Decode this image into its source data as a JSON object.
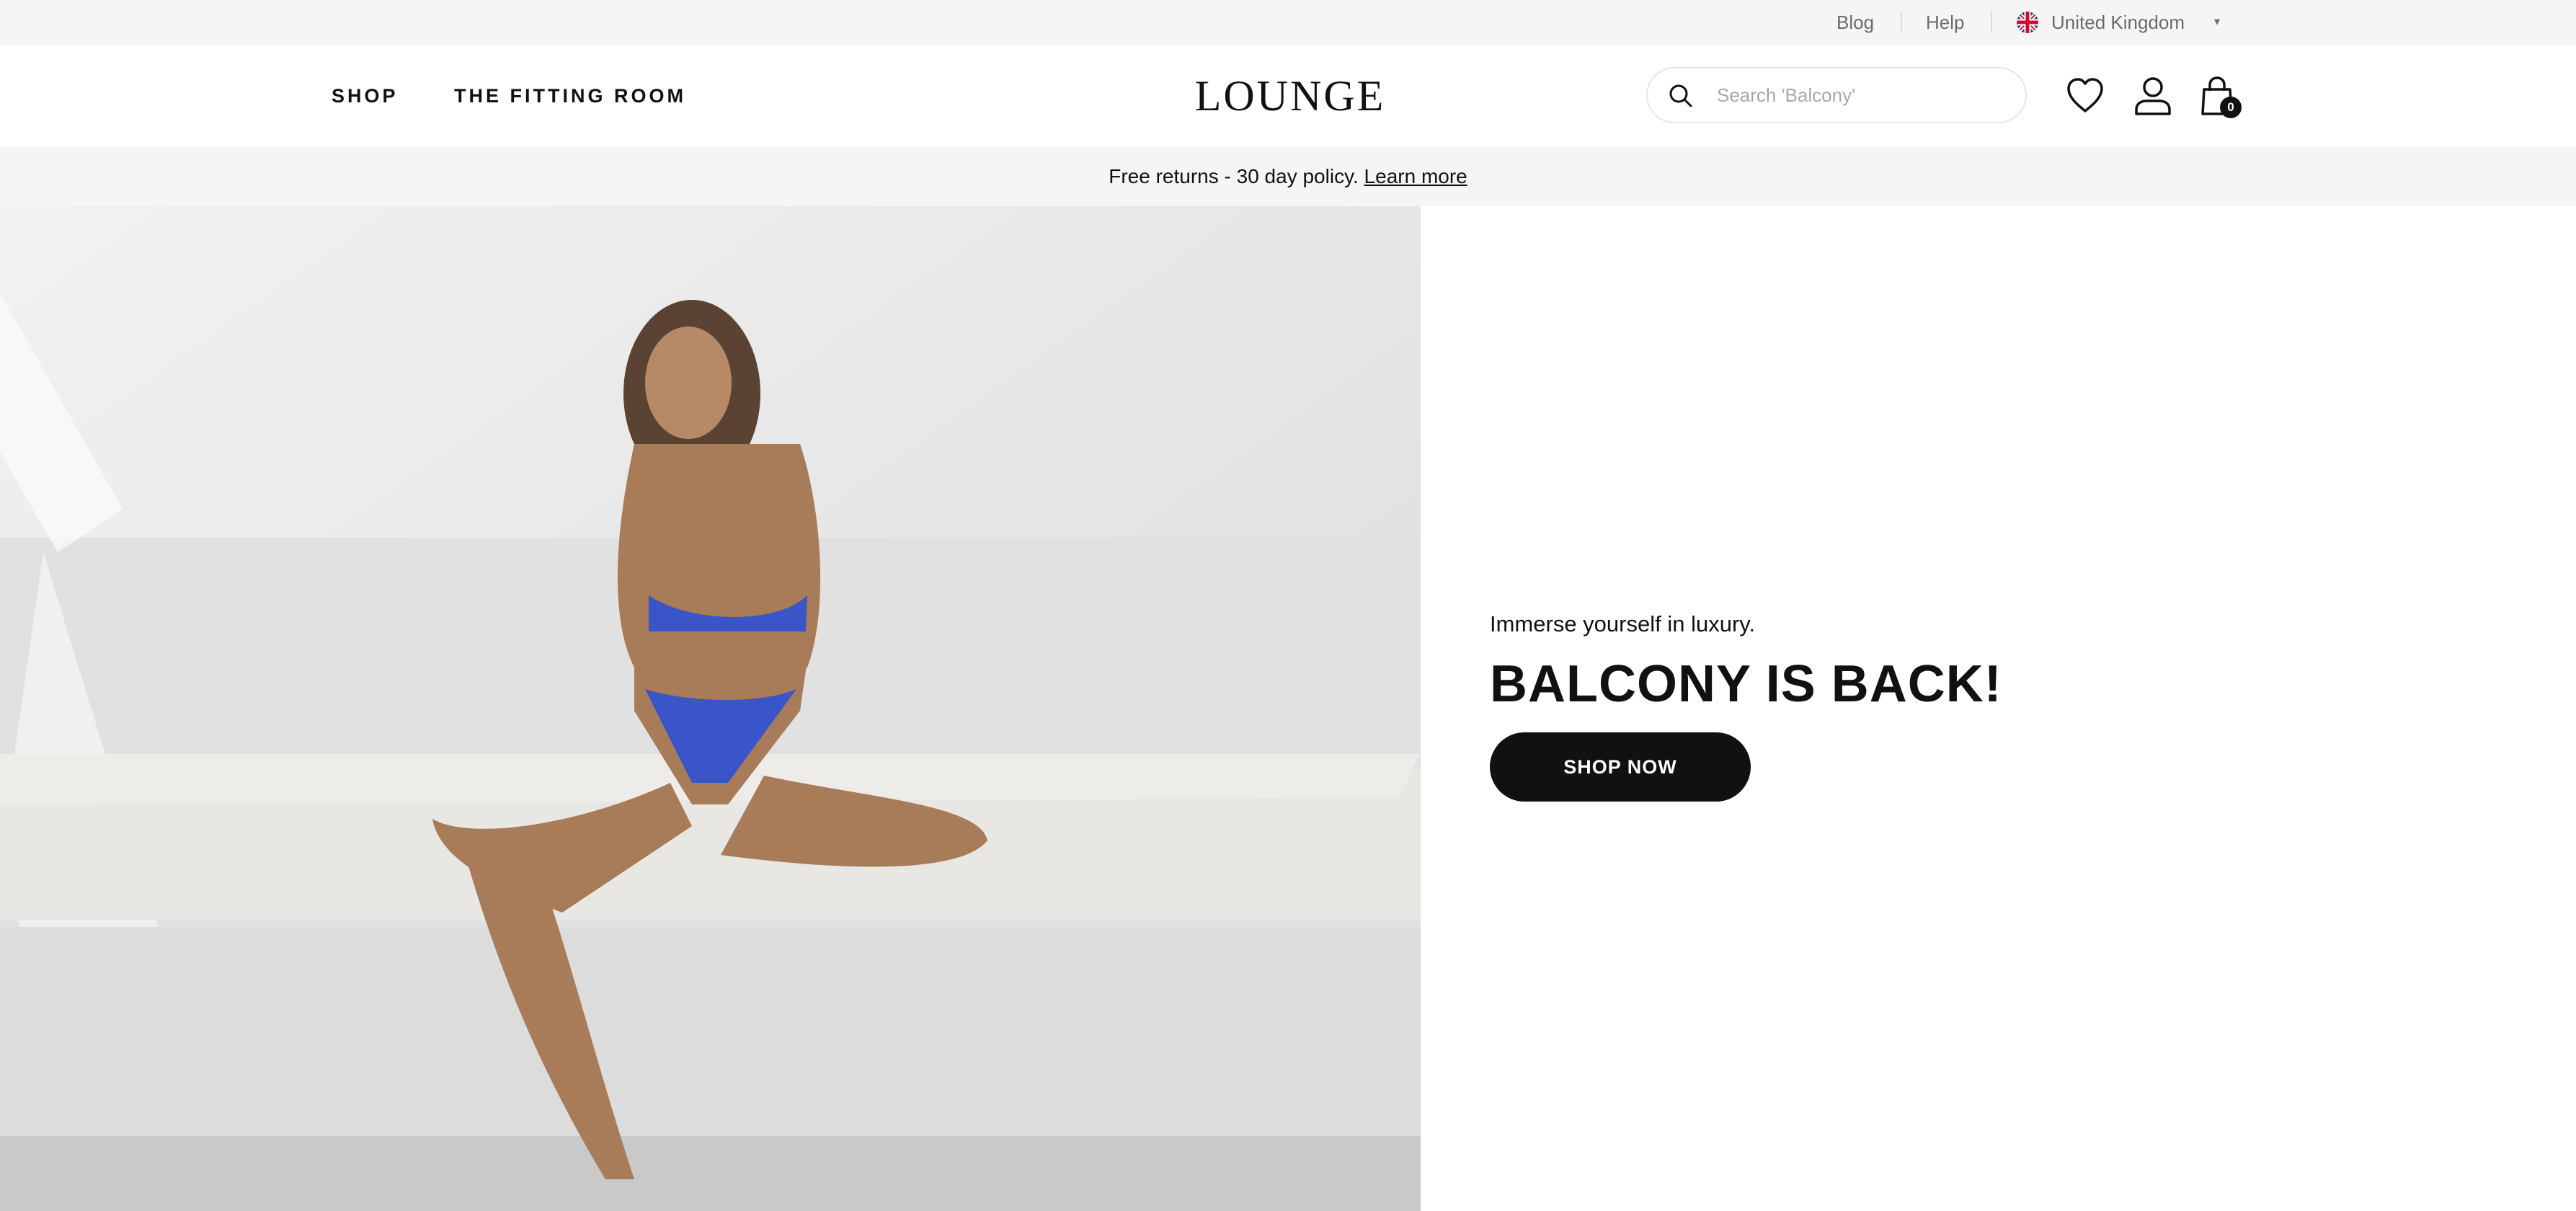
{
  "utility_bar": {
    "blog": "Blog",
    "help": "Help",
    "region": "United Kingdom"
  },
  "header": {
    "nav": [
      "SHOP",
      "THE FITTING ROOM"
    ],
    "logo": "LOUNGE",
    "search_placeholder": "Search 'Balcony'",
    "bag_count": "0"
  },
  "promo": {
    "text": "Free returns - 30 day policy.",
    "link": "Learn more"
  },
  "hero": {
    "eyebrow": "Immerse yourself in luxury.",
    "headline": "BALCONY IS BACK!",
    "cta": "SHOP NOW",
    "lingerie_color": "#3a55c8"
  }
}
